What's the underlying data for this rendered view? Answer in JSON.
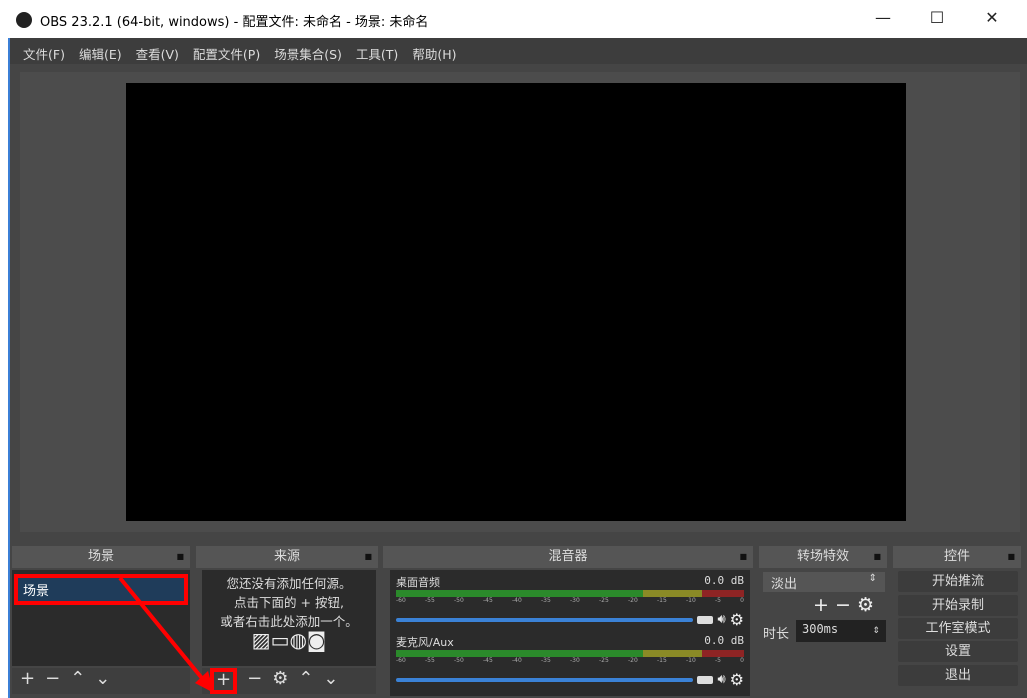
{
  "window": {
    "title": "OBS 23.2.1 (64-bit, windows) - 配置文件: 未命名 - 场景: 未命名",
    "minimize": "—",
    "maximize": "☐",
    "close": "✕"
  },
  "menu": [
    "文件(F)",
    "编辑(E)",
    "查看(V)",
    "配置文件(P)",
    "场景集合(S)",
    "工具(T)",
    "帮助(H)"
  ],
  "docks": {
    "scenes": {
      "title": "场景",
      "items": [
        "场景"
      ]
    },
    "sources": {
      "title": "来源",
      "empty": [
        "您还没有添加任何源。",
        "点击下面的 + 按钮,",
        "或者右击此处添加一个。"
      ]
    },
    "mixer": {
      "title": "混音器",
      "channels": [
        {
          "name": "桌面音频",
          "db": "0.0 dB",
          "volume": 1.0
        },
        {
          "name": "麦克风/Aux",
          "db": "0.0 dB",
          "volume": 1.0
        }
      ],
      "scale": [
        "-60",
        "-55",
        "-50",
        "-45",
        "-40",
        "-35",
        "-30",
        "-25",
        "-20",
        "-15",
        "-10",
        "-5",
        "0"
      ]
    },
    "transitions": {
      "title": "转场特效",
      "selected": "淡出",
      "duration_label": "时长",
      "duration": "300ms"
    },
    "controls": {
      "title": "控件",
      "buttons": [
        "开始推流",
        "开始录制",
        "工作室模式",
        "设置",
        "退出"
      ]
    }
  },
  "colors": {
    "accent": "#3b82d6",
    "annotation": "#ff0000"
  }
}
